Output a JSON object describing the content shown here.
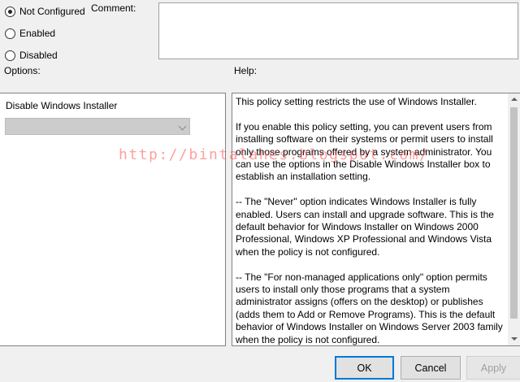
{
  "state_radios": [
    {
      "label": "Not Configured",
      "checked": true
    },
    {
      "label": "Enabled",
      "checked": false
    },
    {
      "label": "Disabled",
      "checked": false
    }
  ],
  "comment": {
    "label": "Comment:",
    "value": ""
  },
  "options": {
    "label": "Options:",
    "title": "Disable Windows Installer",
    "combo_value": ""
  },
  "help": {
    "label": "Help:",
    "paragraphs": [
      "This policy setting restricts the use of Windows Installer.",
      "If you enable this policy setting, you can prevent users from installing software on their systems or permit users to install only those programs offered by a system administrator. You can use the options in the Disable Windows Installer box to establish an installation setting.",
      "--   The \"Never\" option indicates Windows Installer is fully enabled. Users can install and upgrade software. This is the default behavior for Windows Installer on Windows 2000 Professional, Windows XP Professional and Windows Vista when the policy is not configured.",
      "--   The \"For non-managed applications only\" option permits users to install only those programs that a system administrator assigns (offers on the desktop) or publishes (adds them to Add or Remove Programs). This is the default behavior of Windows Installer on Windows Server 2003 family when the policy is not configured."
    ]
  },
  "watermark": "http://bintalanes.blogspot.com/",
  "buttons": {
    "ok": "OK",
    "cancel": "Cancel",
    "apply": "Apply"
  }
}
